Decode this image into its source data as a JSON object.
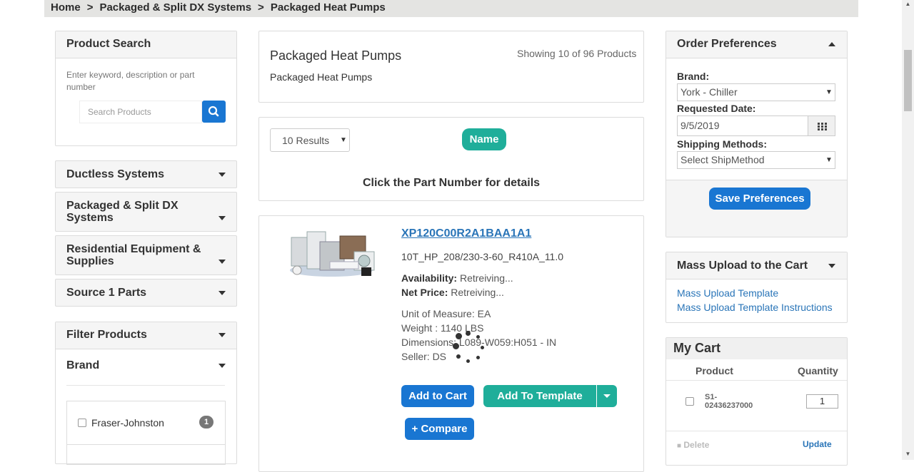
{
  "breadcrumb": {
    "items": [
      "Home",
      "Packaged & Split DX Systems",
      "Packaged Heat Pumps"
    ],
    "separator": ">"
  },
  "product_search": {
    "title": "Product Search",
    "hint": "Enter keyword, description or part number",
    "placeholder": "Search Products"
  },
  "categories": [
    {
      "label": "Ductless Systems"
    },
    {
      "label": "Packaged & Split DX Systems"
    },
    {
      "label": "Residential Equipment & Supplies"
    },
    {
      "label": "Source 1 Parts"
    }
  ],
  "filter": {
    "title": "Filter Products",
    "brand_label": "Brand",
    "brand_items": [
      {
        "label": "Fraser-Johnston",
        "count": "1"
      }
    ]
  },
  "listing": {
    "title": "Packaged Heat Pumps",
    "subtitle": "Packaged Heat Pumps",
    "showing": "Showing 10 of 96 Products",
    "results_select": "10 Results",
    "sort_button": "Name",
    "instruction": "Click the Part Number for details"
  },
  "product": {
    "part_number": "XP120C00R2A1BAA1A1",
    "description": "10T_HP_208/230-3-60_R410A_11.0",
    "availability_label": "Availability:",
    "availability_value": "Retreiving...",
    "price_label": "Net Price:",
    "price_value": "Retreiving...",
    "uom": "Unit of Measure: EA",
    "weight": "Weight : 1140 LBS",
    "dimensions": "Dimensions: L089-W059:H051 - IN",
    "seller": "Seller: DS",
    "add_to_cart": "Add to Cart",
    "add_to_template": "Add To Template",
    "compare": "+ Compare"
  },
  "order_prefs": {
    "title": "Order Preferences",
    "brand_label": "Brand:",
    "brand_value": "York - Chiller",
    "date_label": "Requested Date:",
    "date_value": "9/5/2019",
    "ship_label": "Shipping Methods:",
    "ship_value": "Select ShipMethod",
    "save_button": "Save Preferences"
  },
  "mass_upload": {
    "title": "Mass Upload to the Cart",
    "link1": "Mass Upload Template",
    "link2": "Mass Upload Template Instructions"
  },
  "cart": {
    "title": "My Cart",
    "col_product": "Product",
    "col_quantity": "Quantity",
    "items": [
      {
        "part": "S1-\n02436237000",
        "qty": "1"
      }
    ],
    "delete_label": "Delete",
    "update_label": "Update"
  },
  "colors": {
    "primary_blue": "#1976d2",
    "teal": "#1fae9a",
    "link_blue": "#2a75b8",
    "breadcrumb_bg": "#e4e4e2"
  },
  "icons": {
    "search": "magnifier-icon",
    "calendar": "calendar-grid-icon",
    "caret": "caret-down-icon",
    "trash": "trash-icon"
  }
}
